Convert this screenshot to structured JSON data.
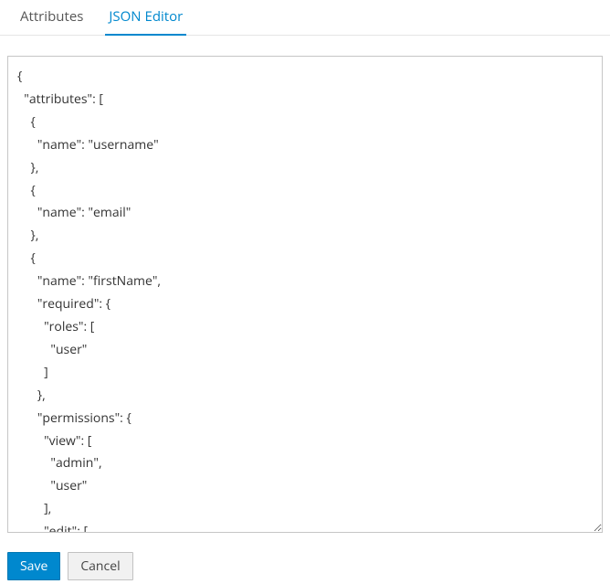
{
  "tabs": {
    "attributes": "Attributes",
    "json_editor": "JSON Editor"
  },
  "editor": {
    "content": "{\n  \"attributes\": [\n    {\n      \"name\": \"username\"\n    },\n    {\n      \"name\": \"email\"\n    },\n    {\n      \"name\": \"firstName\",\n      \"required\": {\n        \"roles\": [\n          \"user\"\n        ]\n      },\n      \"permissions\": {\n        \"view\": [\n          \"admin\",\n          \"user\"\n        ],\n        \"edit\": ["
  },
  "buttons": {
    "save": "Save",
    "cancel": "Cancel"
  }
}
